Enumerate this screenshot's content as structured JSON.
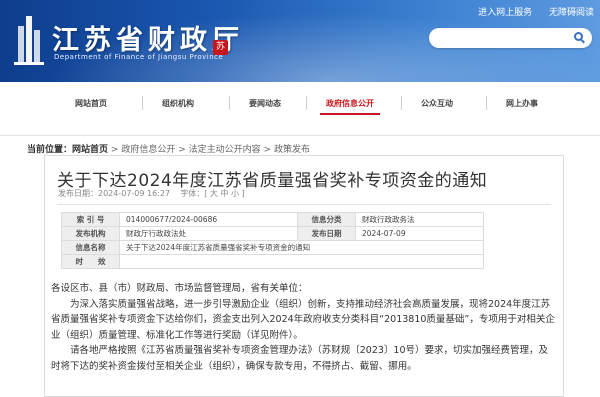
{
  "header": {
    "title": "江苏省财政厅",
    "subtitle": "Department of Finance of Jiangsu Province",
    "seal_char": "苏",
    "top_links": [
      "进入网上服务",
      "无障碍阅读"
    ],
    "search": {
      "placeholder": ""
    }
  },
  "nav": [
    "网站首页",
    "组织机构",
    "要闻动态",
    "政府信息公开",
    "公众互动",
    "网上办事"
  ],
  "nav_active": "政府信息公开",
  "breadcrumb": {
    "prefix": "当前位置：",
    "items": [
      "网站首页",
      "政府信息公开",
      "法定主动公开内容",
      "政策发布"
    ],
    "separator": ">"
  },
  "article": {
    "title": "关于下达2024年度江苏省质量强省奖补专项资金的通知",
    "meta_date": "发布日期：2024-07-09  16:27",
    "meta_font": "字体：[ 大 中 小 ]",
    "info": {
      "row1": {
        "l1": "索 引 号",
        "v1": "014000677/2024-00686",
        "l2": "信息分类",
        "v2": "财政行政政务法"
      },
      "row2": {
        "l1": "发布机构",
        "v1": "财政厅行政政法处",
        "l2": "发布日期",
        "v2": "2024-07-09"
      },
      "row3": {
        "l1": "信息名称",
        "v1": "关于下达2024年度江苏省质量强省奖补专项资金的通知"
      },
      "row4": {
        "l1": "时　　效",
        "v1": ""
      }
    },
    "paragraphs": [
      "各设区市、县（市）财政局、市场监督管理局，省有关单位：",
      "为深入落实质量强省战略，进一步引导激励企业（组织）创新，支持推动经济社会高质量发展，现将2024年度江苏省质量强省奖补专项资金下达给你们，资金支出列入2024年政府收支分类科目“2013810质量基础”，专项用于对相关企业（组织）质量管理、标准化工作等进行奖励（详见附件）。",
      "请各地严格按照《江苏省质量强省奖补专项资金管理办法》（苏财规〔2023〕10号）要求，切实加强经费管理，及时将下达的奖补资金拨付至相关企业（组织），确保专款专用，不得挤占、截留、挪用。"
    ]
  },
  "colors": {
    "header_dark": "#0e3d8c",
    "header_light": "#5e9be0",
    "active": "#c8161d"
  }
}
